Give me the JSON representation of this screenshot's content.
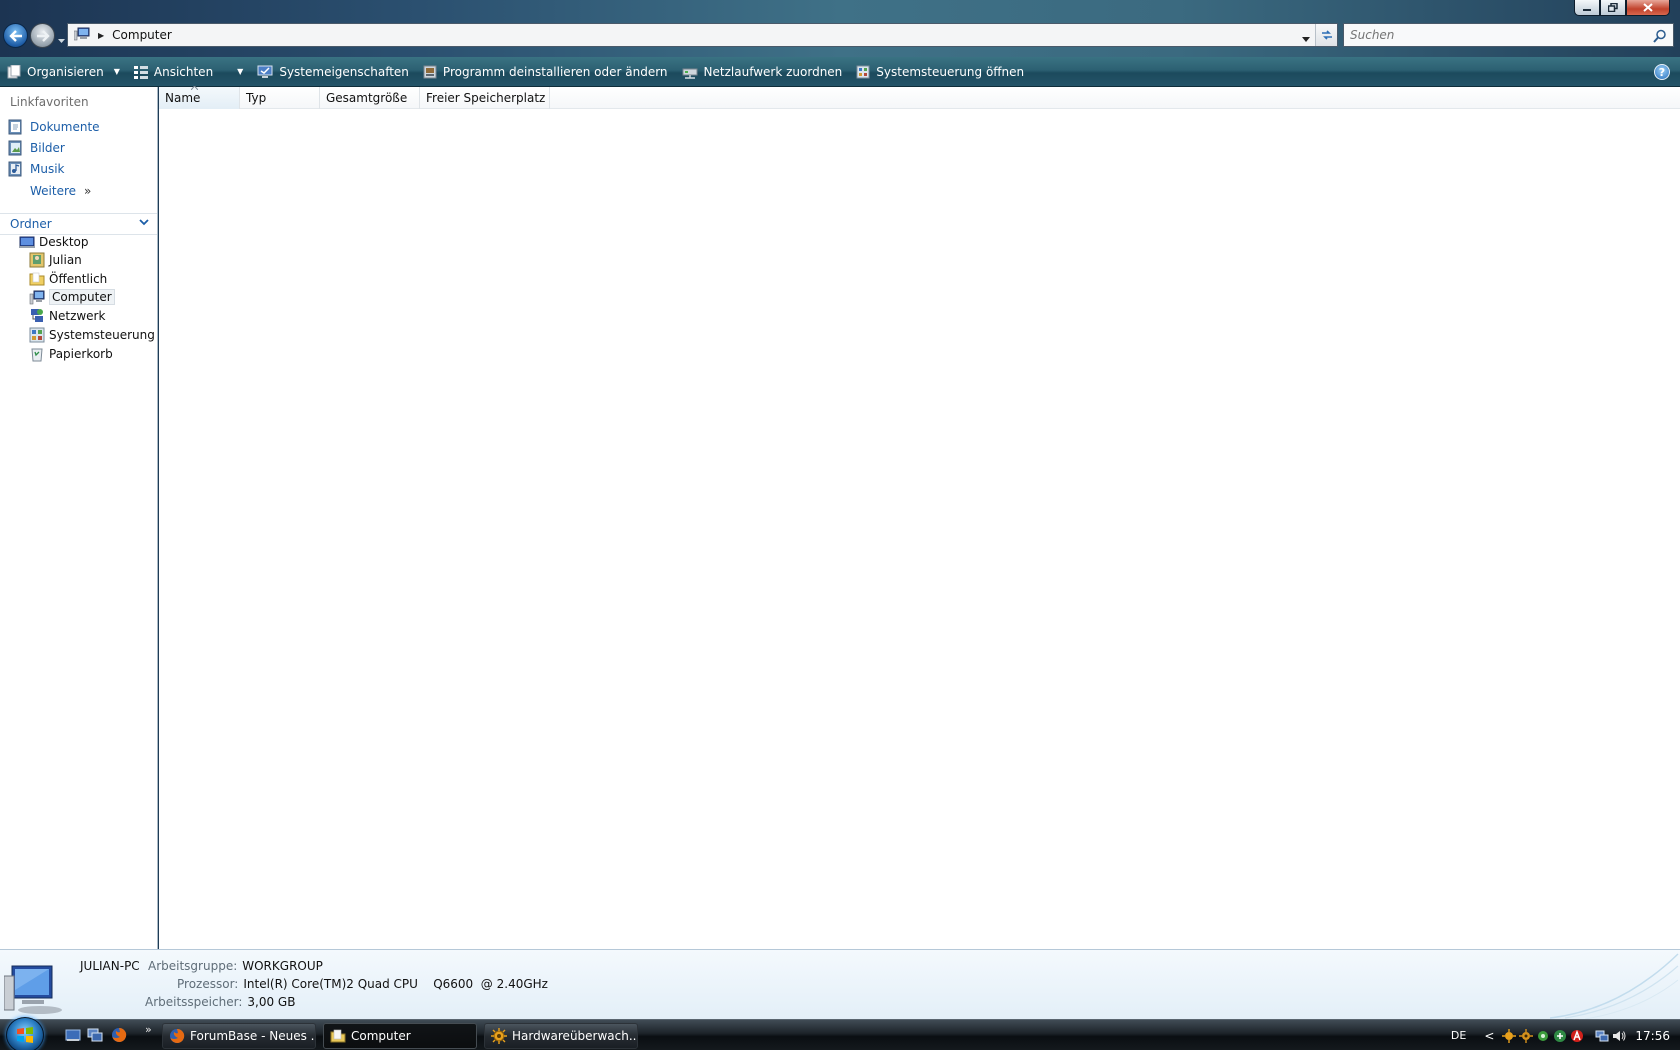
{
  "address_bar": {
    "breadcrumb": "Computer",
    "search_placeholder": "Suchen"
  },
  "command_bar": {
    "items": [
      {
        "label": "Organisieren",
        "icon": "organize-icon",
        "has_dropdown": true
      },
      {
        "label": "Ansichten",
        "icon": "views-icon",
        "has_dropdown": true
      },
      {
        "label": "Systemeigenschaften",
        "icon": "system-properties-icon"
      },
      {
        "label": "Programm deinstallieren oder ändern",
        "icon": "uninstall-program-icon"
      },
      {
        "label": "Netzlaufwerk zuordnen",
        "icon": "network-drive-icon"
      },
      {
        "label": "Systemsteuerung öffnen",
        "icon": "control-panel-icon"
      }
    ],
    "help": "?"
  },
  "nav_pane": {
    "favorites_heading": "Linkfavoriten",
    "favorites": [
      {
        "label": "Dokumente",
        "icon": "documents-icon"
      },
      {
        "label": "Bilder",
        "icon": "pictures-icon"
      },
      {
        "label": "Musik",
        "icon": "music-icon"
      }
    ],
    "more_label": "Weitere",
    "more_glyph": "»",
    "folders_heading": "Ordner",
    "tree": [
      {
        "label": "Desktop",
        "icon": "desktop-icon"
      },
      {
        "label": "Julian",
        "icon": "user-folder-icon"
      },
      {
        "label": "Öffentlich",
        "icon": "public-folder-icon"
      },
      {
        "label": "Computer",
        "icon": "computer-icon",
        "selected": true
      },
      {
        "label": "Netzwerk",
        "icon": "network-icon"
      },
      {
        "label": "Systemsteuerung",
        "icon": "control-panel-icon"
      },
      {
        "label": "Papierkorb",
        "icon": "recycle-bin-icon"
      }
    ]
  },
  "file_list": {
    "columns": [
      "Name",
      "Typ",
      "Gesamtgröße",
      "Freier Speicherplatz"
    ],
    "sorted_column": "Name",
    "rows": []
  },
  "details_pane": {
    "computer_name": "JULIAN-PC",
    "workgroup_label": "Arbeitsgruppe:",
    "workgroup_value": "WORKGROUP",
    "processor_label": "Prozessor:",
    "processor_value": "Intel(R) Core(TM)2 Quad CPU    Q6600  @ 2.40GHz",
    "memory_label": "Arbeitsspeicher:",
    "memory_value": "3,00 GB"
  },
  "taskbar": {
    "quick_launch": [
      "show-desktop-icon",
      "switch-windows-icon",
      "firefox-icon"
    ],
    "quick_launch_more": "»",
    "buttons": [
      {
        "label": "ForumBase - Neues ...",
        "icon": "firefox-icon",
        "active": false
      },
      {
        "label": "Computer",
        "icon": "explorer-icon",
        "active": true
      },
      {
        "label": "Hardwareüberwach...",
        "icon": "hardware-monitor-icon",
        "active": false
      }
    ],
    "language": "DE",
    "show_hidden_icons": "<",
    "clock": "17:56"
  },
  "colors": {
    "link": "#1c5ea8",
    "command_bar": "#2c6072",
    "details_pane": "#e3eff8"
  }
}
